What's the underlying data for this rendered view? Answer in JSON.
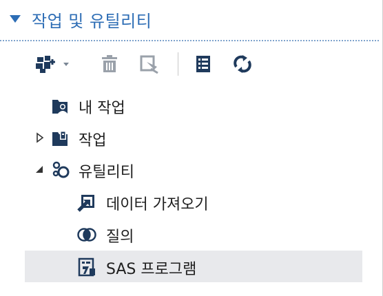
{
  "section": {
    "title": "작업 및 유틸리티",
    "expanded": true,
    "accent_color": "#2d6db5"
  },
  "toolbar": {
    "buttons": [
      {
        "icon": "new-task-icon",
        "has_dropdown": true
      },
      {
        "icon": "trash-icon"
      },
      {
        "icon": "edit-properties-icon"
      },
      {
        "icon": "list-details-icon"
      },
      {
        "icon": "refresh-icon"
      }
    ]
  },
  "tree": {
    "my_tasks": {
      "label": "내 작업",
      "icon": "my-tasks-folder-icon"
    },
    "tasks": {
      "label": "작업",
      "icon": "tasks-folder-icon",
      "expanded": false
    },
    "utilities": {
      "label": "유틸리티",
      "icon": "utilities-icon",
      "expanded": true,
      "children": [
        {
          "label": "데이터 가져오기",
          "icon": "import-data-icon"
        },
        {
          "label": "질의",
          "icon": "query-icon"
        },
        {
          "label": "SAS 프로그램",
          "icon": "sas-program-icon",
          "selected": true
        }
      ]
    }
  }
}
